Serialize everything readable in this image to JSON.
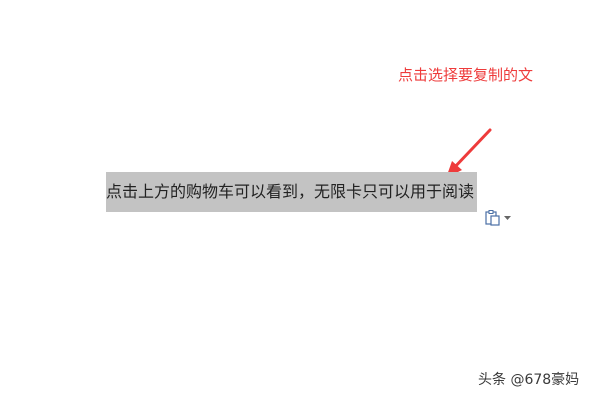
{
  "annotation": {
    "text": "点击选择要复制的文",
    "color": "#ee3b3b"
  },
  "document": {
    "selected_text": "点击上方的购物车可以看到，无限卡只可以用于阅读",
    "selection_color": "#c3c3c3"
  },
  "paste_options": {
    "icon": "clipboard-icon",
    "dropdown_icon": "chevron-down-icon"
  },
  "watermark": {
    "text": "头条 @678豪妈"
  }
}
